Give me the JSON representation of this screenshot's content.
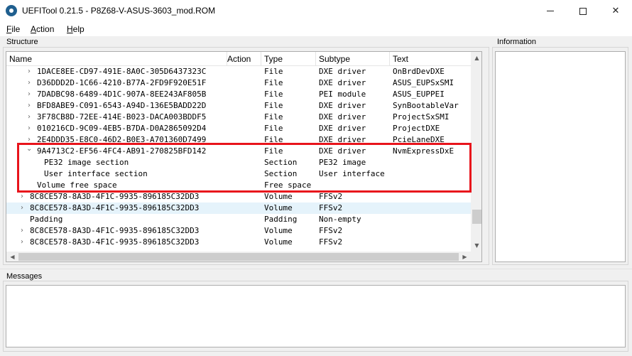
{
  "window": {
    "title": "UEFITool 0.21.5 - P8Z68-V-ASUS-3603_mod.ROM",
    "minimize_label": "",
    "close_label": "✕"
  },
  "menu": {
    "file": {
      "accel": "F",
      "rest": "ile"
    },
    "action": {
      "accel": "A",
      "rest": "ction"
    },
    "help": {
      "accel": "H",
      "rest": "elp"
    }
  },
  "panels": {
    "structure": "Structure",
    "information": "Information",
    "messages": "Messages"
  },
  "columns": [
    "Name",
    "Action",
    "Type",
    "Subtype",
    "Text"
  ],
  "rows": [
    {
      "indent": 2,
      "chevron": "›",
      "name": "1DACE8EE-CD97-491E-8A0C-305D6437323C",
      "action": "",
      "type": "File",
      "subtype": "DXE driver",
      "text": "OnBrdDevDXE"
    },
    {
      "indent": 2,
      "chevron": "›",
      "name": "D36DDD2D-1C66-4210-B77A-2FD9F920E51F",
      "action": "",
      "type": "File",
      "subtype": "DXE driver",
      "text": "ASUS_EUPSxSMI"
    },
    {
      "indent": 2,
      "chevron": "›",
      "name": "7DADBC98-6489-4D1C-907A-8EE243AF805B",
      "action": "",
      "type": "File",
      "subtype": "PEI module",
      "text": "ASUS_EUPPEI"
    },
    {
      "indent": 2,
      "chevron": "›",
      "name": "BFD8ABE9-C091-6543-A94D-136E5BADD22D",
      "action": "",
      "type": "File",
      "subtype": "DXE driver",
      "text": "SynBootableVar"
    },
    {
      "indent": 2,
      "chevron": "›",
      "name": "3F78CB8D-72EE-414E-B023-DACA003BDDF5",
      "action": "",
      "type": "File",
      "subtype": "DXE driver",
      "text": "ProjectSxSMI"
    },
    {
      "indent": 2,
      "chevron": "›",
      "name": "010216CD-9C09-4EB5-B7DA-D0A2865092D4",
      "action": "",
      "type": "File",
      "subtype": "DXE driver",
      "text": "ProjectDXE"
    },
    {
      "indent": 2,
      "chevron": "›",
      "name": "2E4DDD35-E8C0-46D2-B0E3-A701360D7499",
      "action": "",
      "type": "File",
      "subtype": "DXE driver",
      "text": "PcieLaneDXE"
    },
    {
      "indent": 2,
      "chevron": "⌄",
      "name": "9A4713C2-EF56-4FC4-AB91-270825BFD142",
      "action": "",
      "type": "File",
      "subtype": "DXE driver",
      "text": "NvmExpressDxE"
    },
    {
      "indent": 3,
      "chevron": "",
      "name": "PE32 image section",
      "action": "",
      "type": "Section",
      "subtype": "PE32 image",
      "text": ""
    },
    {
      "indent": 3,
      "chevron": "",
      "name": "User interface section",
      "action": "",
      "type": "Section",
      "subtype": "User interface",
      "text": ""
    },
    {
      "indent": 2,
      "chevron": "",
      "name": "Volume free space",
      "action": "",
      "type": "Free space",
      "subtype": "",
      "text": ""
    },
    {
      "indent": 1,
      "chevron": "›",
      "name": "8C8CE578-8A3D-4F1C-9935-896185C32DD3",
      "action": "",
      "type": "Volume",
      "subtype": "FFSv2",
      "text": ""
    },
    {
      "indent": 1,
      "chevron": "›",
      "name": "8C8CE578-8A3D-4F1C-9935-896185C32DD3",
      "action": "",
      "type": "Volume",
      "subtype": "FFSv2",
      "text": "",
      "selected": true
    },
    {
      "indent": 1,
      "chevron": "",
      "name": "Padding",
      "action": "",
      "type": "Padding",
      "subtype": "Non-empty",
      "text": ""
    },
    {
      "indent": 1,
      "chevron": "›",
      "name": "8C8CE578-8A3D-4F1C-9935-896185C32DD3",
      "action": "",
      "type": "Volume",
      "subtype": "FFSv2",
      "text": ""
    },
    {
      "indent": 1,
      "chevron": "›",
      "name": "8C8CE578-8A3D-4F1C-9935-896185C32DD3",
      "action": "",
      "type": "Volume",
      "subtype": "FFSv2",
      "text": ""
    }
  ],
  "colors": {
    "highlight_border": "#e8141c",
    "selected_row": "#e5f3fb",
    "app_icon": "#1f5f8f"
  }
}
